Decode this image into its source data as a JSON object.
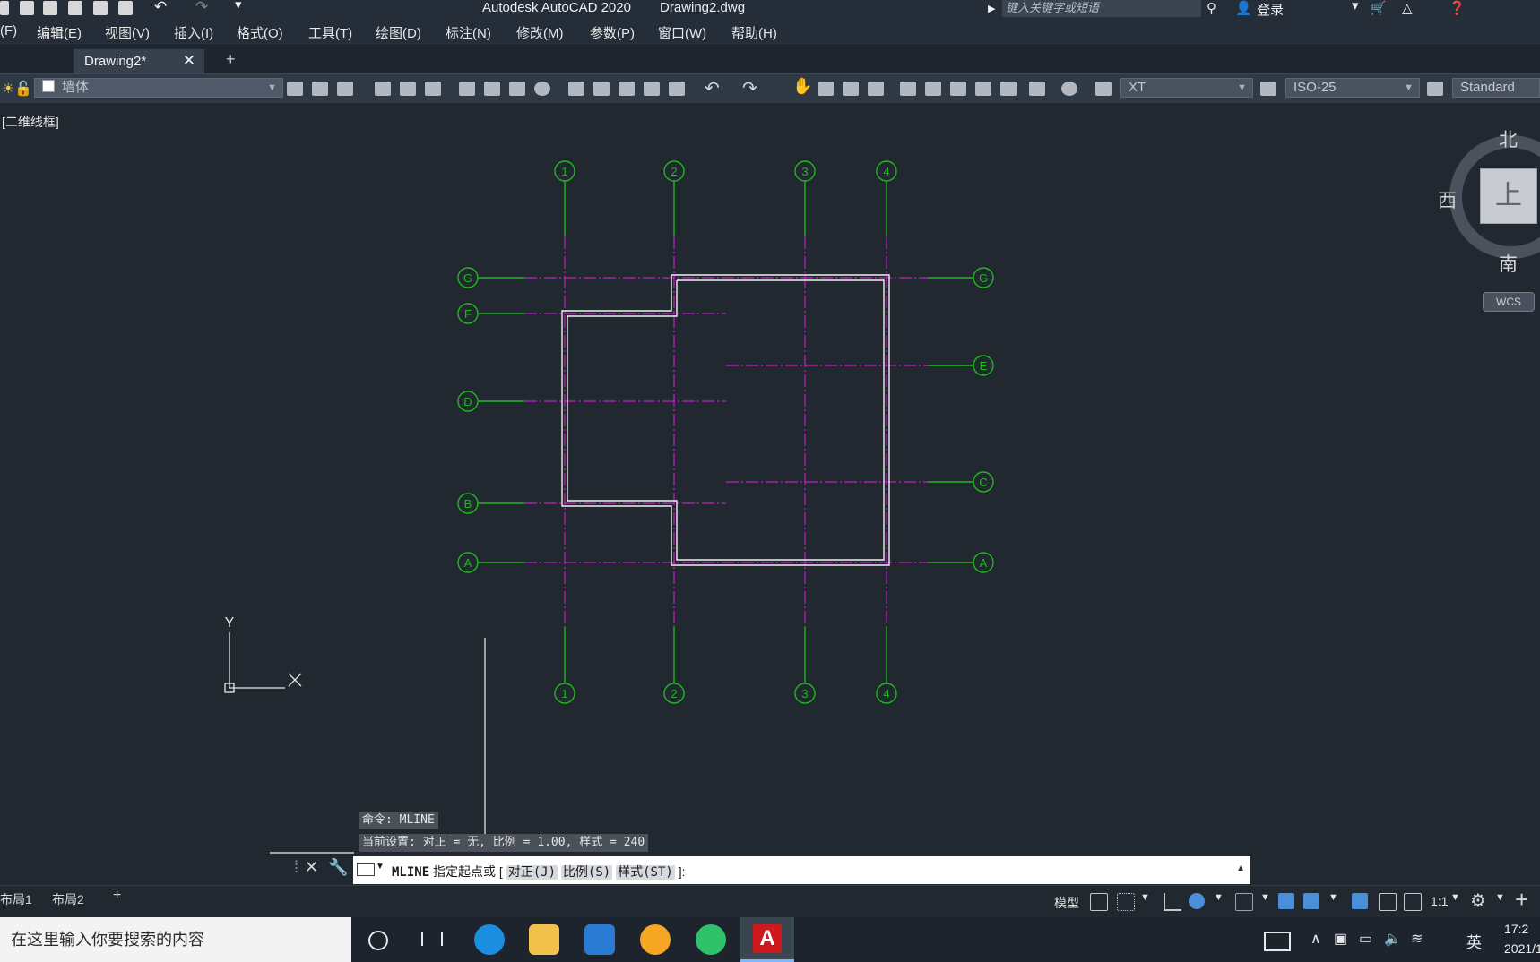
{
  "window": {
    "title": "Autodesk AutoCAD 2020",
    "filename": "Drawing2.dwg",
    "search_placeholder": "键入关键字或短语",
    "login": "登录"
  },
  "menu": [
    "(F)",
    "编辑(E)",
    "视图(V)",
    "插入(I)",
    "格式(O)",
    "工具(T)",
    "绘图(D)",
    "标注(N)",
    "修改(M)",
    "参数(P)",
    "窗口(W)",
    "帮助(H)"
  ],
  "tabs": {
    "active": "Drawing2*",
    "close": "✕",
    "new": "+"
  },
  "toolbar": {
    "layer": "墙体",
    "text_style": "XT",
    "dim_style": "ISO-25",
    "table_style": "Standard"
  },
  "viewport": {
    "label": "[二维线框]"
  },
  "viewcube": {
    "north": "北",
    "west": "西",
    "south": "南",
    "top": "上",
    "wcs": "WCS"
  },
  "ucs": {
    "y": "Y",
    "x": "X"
  },
  "grid": {
    "col_labels": [
      "1",
      "2",
      "3",
      "4"
    ],
    "row_labels_left": [
      "G",
      "F",
      "D",
      "B",
      "A"
    ],
    "row_labels_right": [
      "G",
      "E",
      "C",
      "A"
    ]
  },
  "command": {
    "history1": "命令:  MLINE",
    "history2": "当前设置: 对正 = 无, 比例 = 1.00, 样式 = 240",
    "name": "MLINE",
    "prompt": "指定起点或 [",
    "opt1": "对正(J)",
    "opt2": "比例(S)",
    "opt3": "样式(ST)",
    "suffix": "]:"
  },
  "layout_tabs": [
    "布局1",
    "布局2",
    "+"
  ],
  "status": {
    "model": "模型",
    "scale": "1:1"
  },
  "taskbar": {
    "search": "在这里输入你要搜索的内容",
    "ime": "英",
    "time": "17:2",
    "date": "2021/1"
  },
  "colors": {
    "axis_green": "#1fb81f",
    "axis_magenta": "#c41ec4",
    "wall_white": "#f0f0f0",
    "canvas": "#212830"
  }
}
